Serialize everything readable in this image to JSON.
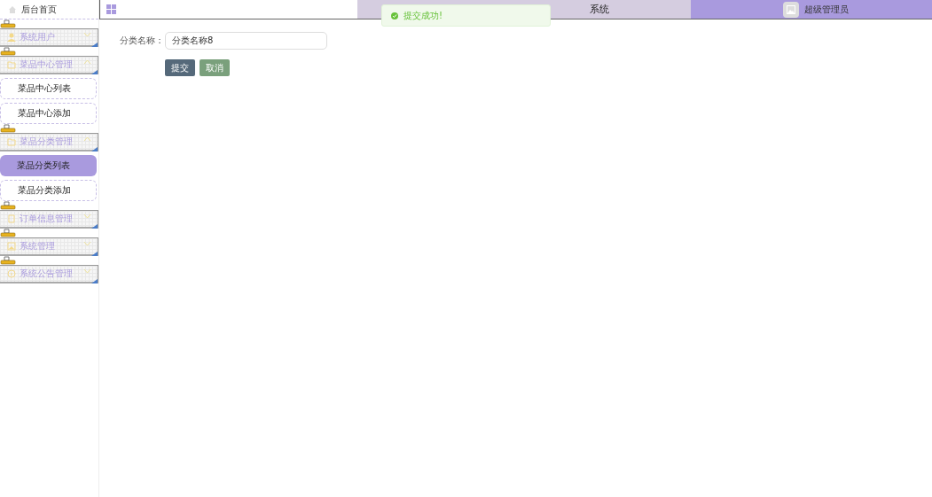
{
  "sidebar": {
    "home": {
      "label": "后台首页"
    },
    "groups": [
      {
        "label": "系统用户",
        "expanded": false
      },
      {
        "label": "菜品中心管理",
        "expanded": true,
        "children": [
          {
            "label": "菜品中心列表",
            "selected": false
          },
          {
            "label": "菜品中心添加",
            "selected": false
          }
        ]
      },
      {
        "label": "菜品分类管理",
        "expanded": true,
        "children": [
          {
            "label": "菜品分类列表",
            "selected": true
          },
          {
            "label": "菜品分类添加",
            "selected": false
          }
        ]
      },
      {
        "label": "订单信息管理",
        "expanded": false
      },
      {
        "label": "系统管理",
        "expanded": false
      },
      {
        "label": "系统公告管理",
        "expanded": false
      }
    ]
  },
  "header": {
    "title": "系统",
    "user": "超级管理员"
  },
  "toast": {
    "kind": "success",
    "message": "提交成功!"
  },
  "form": {
    "fields": [
      {
        "label": "分类名称：",
        "value": "分类名称8"
      }
    ],
    "buttons": [
      {
        "label": "提交",
        "kind": "primary"
      },
      {
        "label": "取消",
        "kind": "secondary"
      }
    ]
  }
}
